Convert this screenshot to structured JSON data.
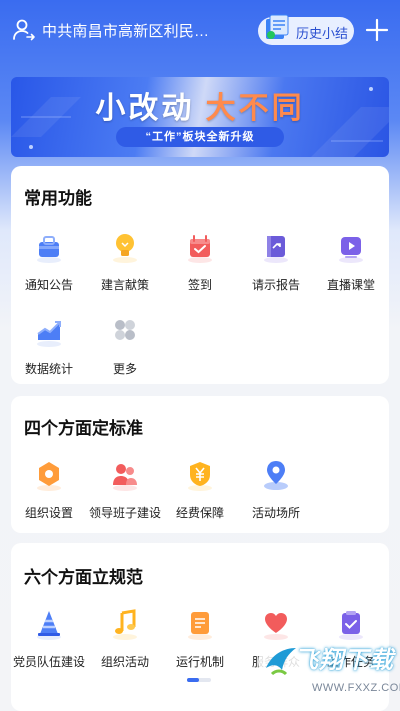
{
  "header": {
    "org_name": "中共南昌市高新区利民…",
    "history_label": "历史小结"
  },
  "banner": {
    "title_part1": "小改动",
    "title_part2": "大不同",
    "subtitle": "“工作”板块全新升级"
  },
  "sections": {
    "common": {
      "title": "常用功能",
      "items": [
        {
          "label": "通知公告",
          "icon": "notice-bag-icon"
        },
        {
          "label": "建言献策",
          "icon": "lightbulb-icon"
        },
        {
          "label": "签到",
          "icon": "calendar-check-icon"
        },
        {
          "label": "请示报告",
          "icon": "report-book-icon"
        },
        {
          "label": "直播课堂",
          "icon": "live-play-icon"
        },
        {
          "label": "数据统计",
          "icon": "trend-chart-icon"
        },
        {
          "label": "更多",
          "icon": "more-grid-icon"
        }
      ]
    },
    "four": {
      "title": "四个方面定标准",
      "items": [
        {
          "label": "组织设置",
          "icon": "hexagon-org-icon"
        },
        {
          "label": "领导班子建设",
          "icon": "team-people-icon"
        },
        {
          "label": "经费保障",
          "icon": "yuan-shield-icon"
        },
        {
          "label": "活动场所",
          "icon": "location-pin-icon"
        }
      ]
    },
    "six": {
      "title": "六个方面立规范",
      "items": [
        {
          "label": "党员队伍建设",
          "icon": "cone-icon"
        },
        {
          "label": "组织活动",
          "icon": "music-note-icon"
        },
        {
          "label": "运行机制",
          "icon": "document-icon"
        },
        {
          "label": "服务群众",
          "icon": "heart-icon"
        },
        {
          "label": "工作任务",
          "icon": "task-check-icon"
        }
      ]
    }
  },
  "watermark": {
    "text": "飞翔下载",
    "url": "WWW.FXXZ.COM"
  },
  "colors": {
    "primary": "#3a6cf0",
    "accent_orange": "#ff8a4c"
  }
}
